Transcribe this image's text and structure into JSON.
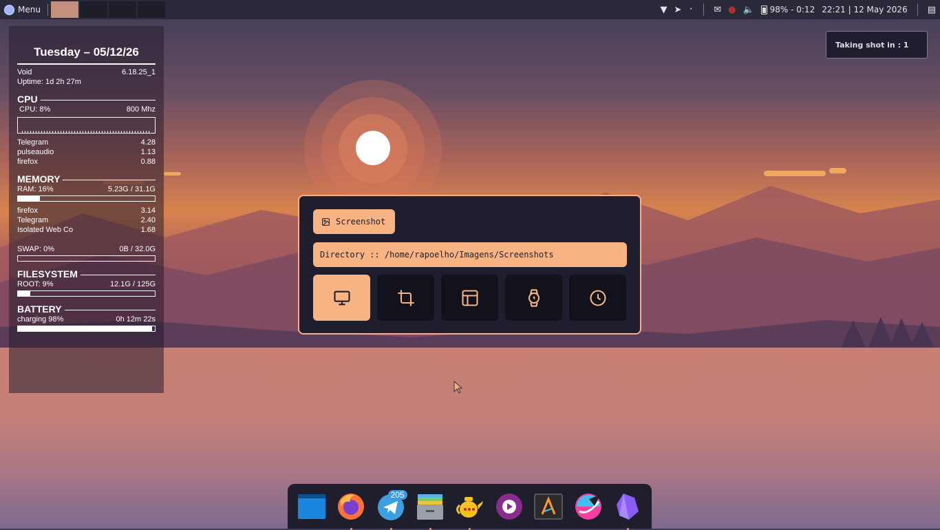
{
  "panel": {
    "menu_label": "Menu",
    "battery_text": "98% - 0:12",
    "clock": "22:21 | 12 May 2026",
    "workspace_count": 5,
    "tray_icons": [
      "wifi-icon",
      "telegram-icon",
      "bluetooth-icon",
      "notification-icon",
      "mic-muted-icon",
      "volume-icon",
      "battery-icon",
      "power-icon"
    ]
  },
  "conky": {
    "date": "Tuesday – 05/12/26",
    "os": "Void",
    "kernel": "6.18.25_1",
    "uptime": "Uptime: 1d 2h 27m",
    "cpu": {
      "heading": "CPU",
      "usage": "CPU: 8%",
      "freq": "800 Mhz",
      "procs": [
        {
          "name": "Telegram",
          "value": "4.28"
        },
        {
          "name": "pulseaudio",
          "value": "1.13"
        },
        {
          "name": "firefox",
          "value": "0.88"
        }
      ]
    },
    "memory": {
      "heading": "MEMORY",
      "ram": "RAM: 16%",
      "ram_used": "5.23G / 31.1G",
      "ram_percent": 16,
      "procs": [
        {
          "name": "firefox",
          "value": "3.14"
        },
        {
          "name": "Telegram",
          "value": "2.40"
        },
        {
          "name": "Isolated Web Co",
          "value": "1.68"
        }
      ],
      "swap": "SWAP: 0%",
      "swap_used": "0B / 32.0G",
      "swap_percent": 0
    },
    "filesystem": {
      "heading": "FILESYSTEM",
      "root": "ROOT:  9%",
      "root_used": "12.1G / 125G",
      "root_percent": 9
    },
    "battery": {
      "heading": "BATTERY",
      "status": "charging 98%",
      "time": "0h 12m 22s",
      "percent": 98
    }
  },
  "notification": {
    "text": "Taking shot in : 1"
  },
  "dialog": {
    "title": "Screenshot",
    "directory": "Directory :: /home/rapoelho/Imagens/Screenshots",
    "options": [
      "screen-icon",
      "crop-icon",
      "window-icon",
      "timer-watch-icon",
      "clock-icon"
    ]
  },
  "dock": {
    "apps": [
      "file-manager",
      "firefox",
      "telegram",
      "archive-manager",
      "teapot-app",
      "media-player",
      "editor",
      "krita",
      "obsidian"
    ],
    "telegram_badge": "205"
  },
  "colors": {
    "accent": "#f8b383",
    "panel": "#2b2a3a",
    "dialog_bg": "#1e1e2e"
  }
}
